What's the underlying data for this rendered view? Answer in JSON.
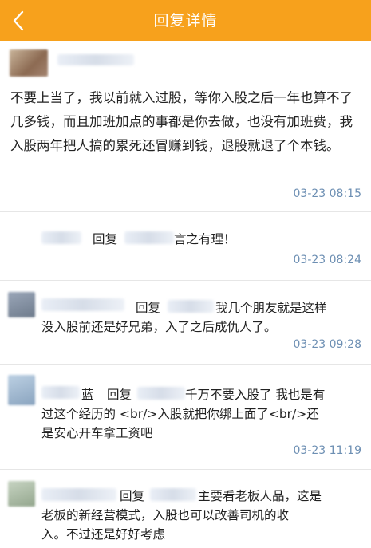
{
  "header": {
    "title": "回复详情",
    "back_icon": "chevron-left-icon",
    "color": "#f7a11c"
  },
  "main_post": {
    "text": "不要上当了，我以前就入过股，等你入股之后一年也算不了几多钱，而且加班加点的事都是你去做，也没有加班费，我入股两年把人搞的累死还冒赚到钱，退股就退了个本钱。",
    "time": "03-23 08:15"
  },
  "replies": [
    {
      "reply_word": "回复",
      "suffix": "言之有理！",
      "time": "03-23 08:24"
    },
    {
      "reply_word": "回复",
      "suffix": "我几个朋友就是这样",
      "text_line2": "没入股前还是好兄弟，入了之后成仇人了。",
      "time": "03-23 09:28"
    },
    {
      "name_tail": "蓝",
      "reply_word": "回复",
      "suffix": "千万不要入股了 我也是有",
      "text_line2": "过这个经历的 <br/>入股就把你绑上面了<br/>还",
      "text_line3": "是安心开车拿工资吧",
      "time": "03-23 11:19"
    },
    {
      "reply_word": "回复",
      "suffix": "主要看老板人品，这是",
      "text_line2": "老板的新经营模式，入股也可以改善司机的收",
      "text_line3": "入。不过还是好好考虑"
    }
  ],
  "timestamp_color": "#6d8fb3"
}
